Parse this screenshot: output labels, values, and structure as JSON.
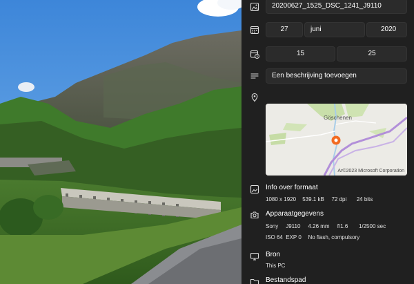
{
  "file_name": "20200627_1525_DSC_1241_J9110",
  "date": {
    "day": "27",
    "month": "juni",
    "year": "2020"
  },
  "time": {
    "hour": "15",
    "minute": "25"
  },
  "description_placeholder": "Een beschrijving toevoegen",
  "map": {
    "place_label": "Göschenen",
    "copyright": "Ar©2023 Microsoft Corporation"
  },
  "format_info": {
    "title": "Info over formaat",
    "dimensions": "1080 x 1920",
    "size": "539.1 kB",
    "dpi": "72 dpi",
    "bits": "24 bits"
  },
  "device": {
    "title": "Apparaatgegevens",
    "make": "Sony",
    "model": "J9110",
    "focal_length": "4.26 mm",
    "aperture": "f/1.6",
    "shutter": "1/2500 sec",
    "iso": "ISO 64",
    "exposure": "EXP 0",
    "flash": "No flash, compulsory"
  },
  "source": {
    "title": "Bron",
    "value": "This PC"
  },
  "file_path": {
    "title": "Bestandspad"
  },
  "colors": {
    "panel_bg": "#202020",
    "field_bg": "#2b2b2b",
    "map_pin": "#f26b21",
    "map_route": "#b28fd9"
  }
}
